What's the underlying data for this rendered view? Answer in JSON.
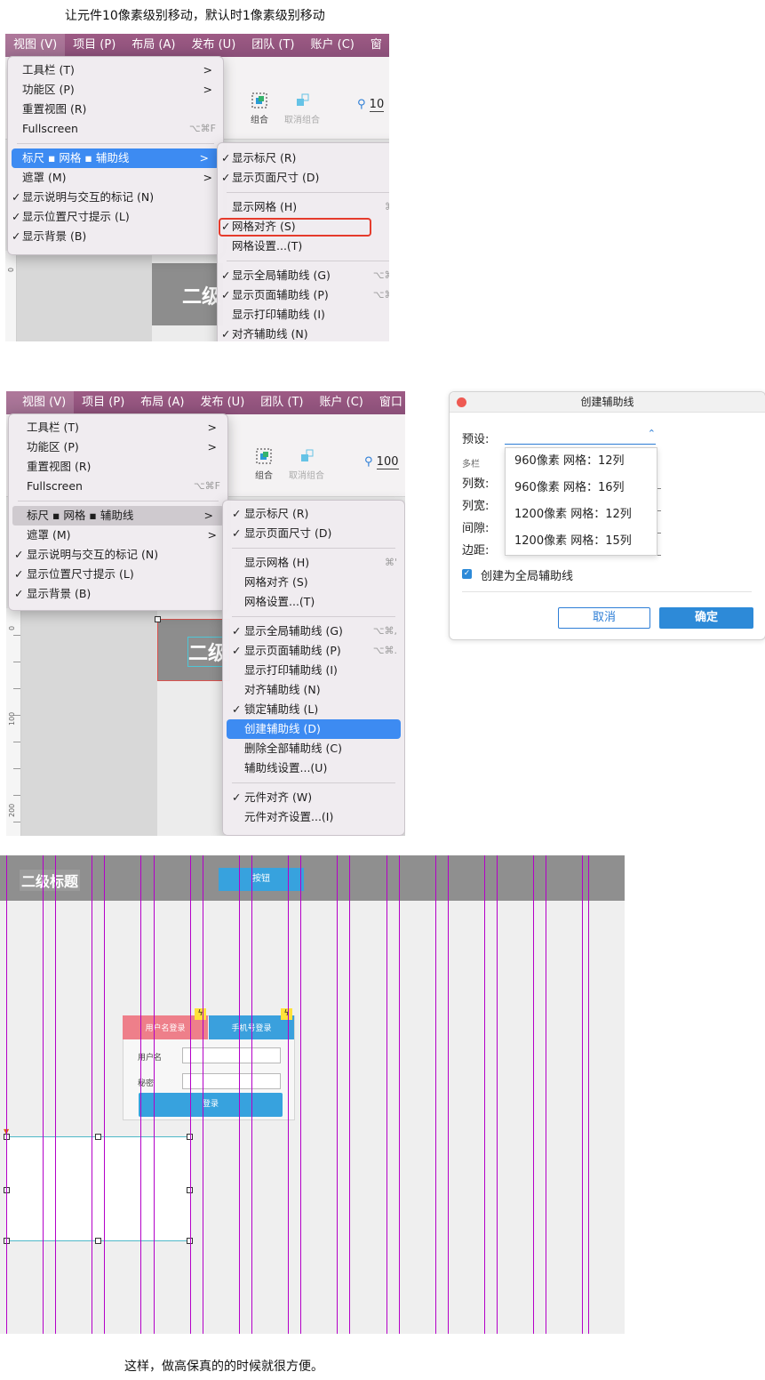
{
  "captions": {
    "top": "让元件10像素级别移动，默认时1像素级别移动",
    "bottom": "这样，做高保真的的时候就很方便。"
  },
  "menubar": [
    "视图 (V)",
    "项目 (P)",
    "布局 (A)",
    "发布 (U)",
    "团队 (T)",
    "账户 (C)",
    "窗"
  ],
  "menubar2": [
    "视图 (V)",
    "项目 (P)",
    "布局 (A)",
    "发布 (U)",
    "团队 (T)",
    "账户 (C)",
    "窗口"
  ],
  "toolbar": {
    "group": "组合",
    "ungroup": "取消组合",
    "zoom1": "10",
    "zoom2": "100"
  },
  "view_menu": [
    {
      "label": "工具栏 (T)",
      "arrow": ">"
    },
    {
      "label": "功能区 (P)",
      "arrow": ">"
    },
    {
      "label": "重置视图 (R)"
    },
    {
      "label": "Fullscreen",
      "shortcut": "⌥⌘F"
    },
    {
      "label": "标尺 ▪ 网格 ▪ 辅助线",
      "arrow": ">"
    },
    {
      "label": "遮罩 (M)",
      "arrow": ">"
    },
    {
      "label": "显示说明与交互的标记 (N)",
      "check": "✓"
    },
    {
      "label": "显示位置尺寸提示 (L)",
      "check": "✓"
    },
    {
      "label": "显示背景 (B)",
      "check": "✓"
    }
  ],
  "sub1": [
    {
      "label": "显示标尺 (R)",
      "check": "✓"
    },
    {
      "label": "显示页面尺寸 (D)",
      "check": "✓"
    },
    {
      "label": "显示网格 (H)",
      "shortcut": "⌘'"
    },
    {
      "label": "网格对齐 (S)",
      "check": "✓"
    },
    {
      "label": "网格设置...(T)"
    },
    {
      "label": "显示全局辅助线 (G)",
      "check": "✓",
      "shortcut": "⌥⌘,"
    },
    {
      "label": "显示页面辅助线 (P)",
      "check": "✓",
      "shortcut": "⌥⌘."
    },
    {
      "label": "显示打印辅助线 (I)"
    },
    {
      "label": "对齐辅助线 (N)",
      "check": "✓"
    }
  ],
  "sub2": [
    {
      "label": "显示标尺 (R)",
      "check": "✓"
    },
    {
      "label": "显示页面尺寸 (D)",
      "check": "✓"
    },
    {
      "label": "显示网格 (H)",
      "shortcut": "⌘'"
    },
    {
      "label": "网格对齐 (S)"
    },
    {
      "label": "网格设置...(T)"
    },
    {
      "label": "显示全局辅助线 (G)",
      "check": "✓",
      "shortcut": "⌥⌘,"
    },
    {
      "label": "显示页面辅助线 (P)",
      "check": "✓",
      "shortcut": "⌥⌘."
    },
    {
      "label": "显示打印辅助线 (I)"
    },
    {
      "label": "对齐辅助线 (N)"
    },
    {
      "label": "锁定辅助线 (L)",
      "check": "✓"
    },
    {
      "label": "创建辅助线 (D)"
    },
    {
      "label": "删除全部辅助线 (C)"
    },
    {
      "label": "辅助线设置...(U)"
    },
    {
      "label": "元件对齐 (W)",
      "check": "✓"
    },
    {
      "label": "元件对齐设置...(I)"
    }
  ],
  "canvas": {
    "heading": "二级",
    "ruler_labels": [
      "0",
      "100",
      "200"
    ]
  },
  "dialog": {
    "title": "创建辅助线",
    "preset_label": "预设:",
    "section": "多栏",
    "fields": [
      "列数:",
      "列宽:",
      "间隙:",
      "边距:"
    ],
    "options": [
      "960像素 网格：12列",
      "960像素 网格：16列",
      "1200像素 网格：12列",
      "1200像素 网格：15列"
    ],
    "checkbox": "创建为全局辅助线",
    "cancel": "取消",
    "ok": "确定"
  },
  "preview": {
    "heading": "二级标题",
    "button": "按钮",
    "tab_user": "用户名登录",
    "tab_phone": "手机号登录",
    "username_label": "用户名",
    "password_label": "秘密",
    "login": "登录"
  },
  "colors": {
    "menubar": "#8a4f78",
    "highlight": "#3d8bf2",
    "guide": "#b400c8",
    "tab_pink": "#ee7f8a",
    "tab_blue": "#3aa0dd",
    "red_box": "#e53b2c"
  }
}
